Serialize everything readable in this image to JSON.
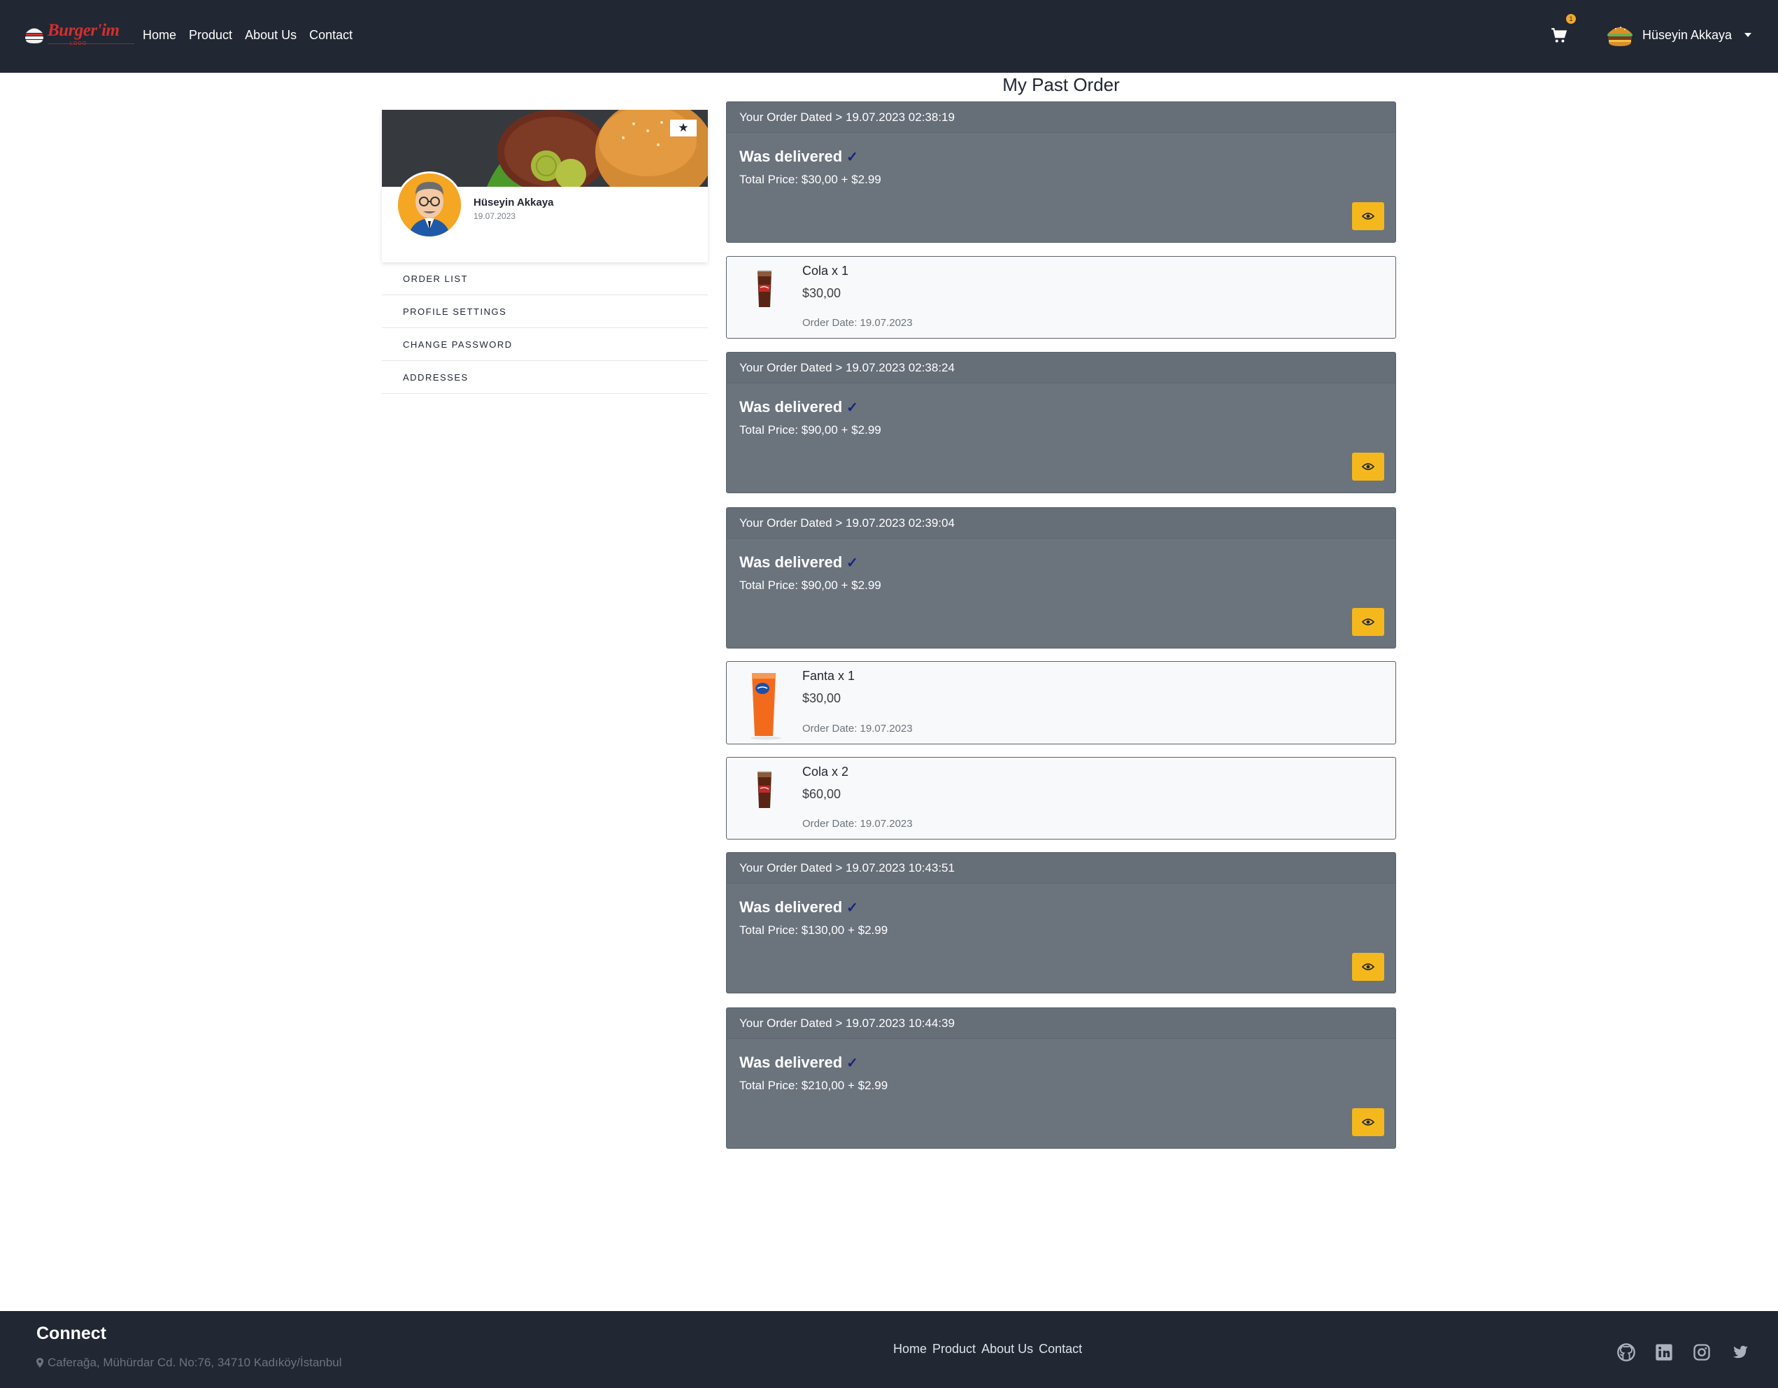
{
  "navbar": {
    "brand": "Burger'im",
    "brand_sub": "LOGO",
    "links": [
      "Home",
      "Product",
      "About Us",
      "Contact"
    ],
    "cart_count": "1",
    "user_name": "Hüseyin Akkaya",
    "icons": {
      "cart": "cart-icon",
      "avatar": "burger-avatar-icon",
      "dropdown": "caret-down-icon"
    }
  },
  "profile": {
    "name": "Hüseyin Akkaya",
    "date": "19.07.2023",
    "star_icon": "star-icon"
  },
  "side_menu": [
    "ORDER LIST",
    "PROFILE SETTINGS",
    "CHANGE PASSWORD",
    "ADDRESSES"
  ],
  "main": {
    "title": "My Past Order",
    "orders": [
      {
        "header": "Your Order Dated > 19.07.2023 02:38:19",
        "status": "Was delivered",
        "total": "Total Price: $30,00 + $2.99"
      },
      {
        "header": "Your Order Dated > 19.07.2023 02:38:24",
        "status": "Was delivered",
        "total": "Total Price: $90,00 + $2.99"
      },
      {
        "header": "Your Order Dated > 19.07.2023 02:39:04",
        "status": "Was delivered",
        "total": "Total Price: $90,00 + $2.99"
      },
      {
        "header": "Your Order Dated > 19.07.2023 10:43:51",
        "status": "Was delivered",
        "total": "Total Price: $130,00 + $2.99"
      },
      {
        "header": "Your Order Dated > 19.07.2023 10:44:39",
        "status": "Was delivered",
        "total": "Total Price: $210,00 + $2.99"
      }
    ],
    "items": [
      {
        "name": "Cola x 1",
        "price": "$30,00",
        "date": "Order Date: 19.07.2023",
        "icon": "cola-glass-icon"
      },
      {
        "name": "Fanta x 1",
        "price": "$30,00",
        "date": "Order Date: 19.07.2023",
        "icon": "fanta-glass-icon"
      },
      {
        "name": "Cola x 2",
        "price": "$60,00",
        "date": "Order Date: 19.07.2023",
        "icon": "cola-glass-icon"
      }
    ],
    "check_icon": "check-icon",
    "eye_icon": "eye-icon"
  },
  "footer": {
    "title": "Connect",
    "address": "Caferağa, Mühürdar Cd. No:76, 34710 Kadıköy/İstanbul",
    "links": [
      "Home",
      "Product",
      "About Us",
      "Contact"
    ],
    "socials": [
      "github-icon",
      "linkedin-icon",
      "instagram-icon",
      "twitter-icon"
    ]
  },
  "colors": {
    "navbar_bg": "#212733",
    "order_card_bg": "#6b737d",
    "accent_yellow": "#f5b81c",
    "brand_red": "#d32f2f",
    "check_navy": "#1a237e"
  }
}
